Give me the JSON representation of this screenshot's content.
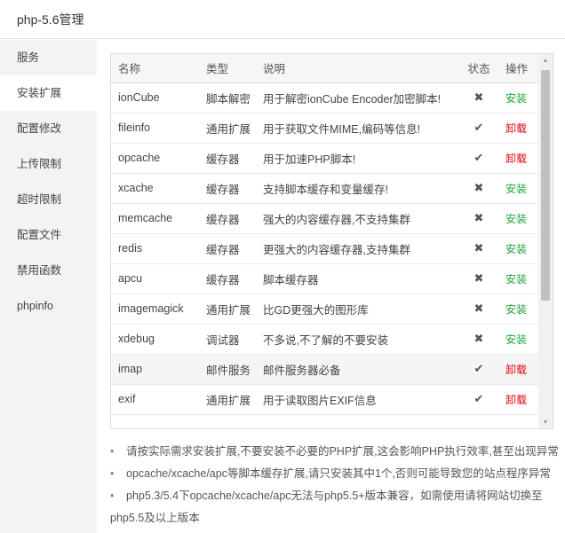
{
  "title": "php-5.6管理",
  "sidebar": {
    "items": [
      {
        "label": "服务",
        "active": false
      },
      {
        "label": "安装扩展",
        "active": true
      },
      {
        "label": "配置修改",
        "active": false
      },
      {
        "label": "上传限制",
        "active": false
      },
      {
        "label": "超时限制",
        "active": false
      },
      {
        "label": "配置文件",
        "active": false
      },
      {
        "label": "禁用函数",
        "active": false
      },
      {
        "label": "phpinfo",
        "active": false
      }
    ]
  },
  "table": {
    "headers": {
      "name": "名称",
      "type": "类型",
      "desc": "说明",
      "status": "状态",
      "action": "操作"
    },
    "rows": [
      {
        "name": "ionCube",
        "type": "脚本解密",
        "desc": "用于解密ionCube Encoder加密脚本!",
        "status_icon": "cross-icon",
        "status_glyph": "✖",
        "action": "安装",
        "action_kind": "install"
      },
      {
        "name": "fileinfo",
        "type": "通用扩展",
        "desc": "用于获取文件MIME,编码等信息!",
        "status_icon": "check-icon",
        "status_glyph": "✔",
        "action": "卸载",
        "action_kind": "uninstall"
      },
      {
        "name": "opcache",
        "type": "缓存器",
        "desc": "用于加速PHP脚本!",
        "status_icon": "check-icon",
        "status_glyph": "✔",
        "action": "卸载",
        "action_kind": "uninstall"
      },
      {
        "name": "xcache",
        "type": "缓存器",
        "desc": "支持脚本缓存和变量缓存!",
        "status_icon": "cross-icon",
        "status_glyph": "✖",
        "action": "安装",
        "action_kind": "install"
      },
      {
        "name": "memcache",
        "type": "缓存器",
        "desc": "强大的内容缓存器,不支持集群",
        "status_icon": "cross-icon",
        "status_glyph": "✖",
        "action": "安装",
        "action_kind": "install"
      },
      {
        "name": "redis",
        "type": "缓存器",
        "desc": "更强大的内容缓存器,支持集群",
        "status_icon": "cross-icon",
        "status_glyph": "✖",
        "action": "安装",
        "action_kind": "install"
      },
      {
        "name": "apcu",
        "type": "缓存器",
        "desc": "脚本缓存器",
        "status_icon": "cross-icon",
        "status_glyph": "✖",
        "action": "安装",
        "action_kind": "install"
      },
      {
        "name": "imagemagick",
        "type": "通用扩展",
        "desc": "比GD更强大的图形库",
        "status_icon": "cross-icon",
        "status_glyph": "✖",
        "action": "安装",
        "action_kind": "install"
      },
      {
        "name": "xdebug",
        "type": "调试器",
        "desc": "不多说,不了解的不要安装",
        "status_icon": "cross-icon",
        "status_glyph": "✖",
        "action": "安装",
        "action_kind": "install"
      },
      {
        "name": "imap",
        "type": "邮件服务",
        "desc": "邮件服务器必备",
        "status_icon": "check-icon",
        "status_glyph": "✔",
        "action": "卸载",
        "action_kind": "uninstall"
      },
      {
        "name": "exif",
        "type": "通用扩展",
        "desc": "用于读取图片EXIF信息",
        "status_icon": "check-icon",
        "status_glyph": "✔",
        "action": "卸载",
        "action_kind": "uninstall"
      }
    ]
  },
  "notes": [
    "请按实际需求安装扩展,不要安装不必要的PHP扩展,这会影响PHP执行效率,甚至出现异常",
    "opcache/xcache/apc等脚本缓存扩展,请只安装其中1个,否则可能导致您的站点程序异常",
    "php5.3/5.4下opcache/xcache/apc无法与php5.5+版本兼容，如需使用请将网站切换至php5.5及以上版本"
  ],
  "colors": {
    "install": "#20a53a",
    "uninstall": "#e60012"
  }
}
